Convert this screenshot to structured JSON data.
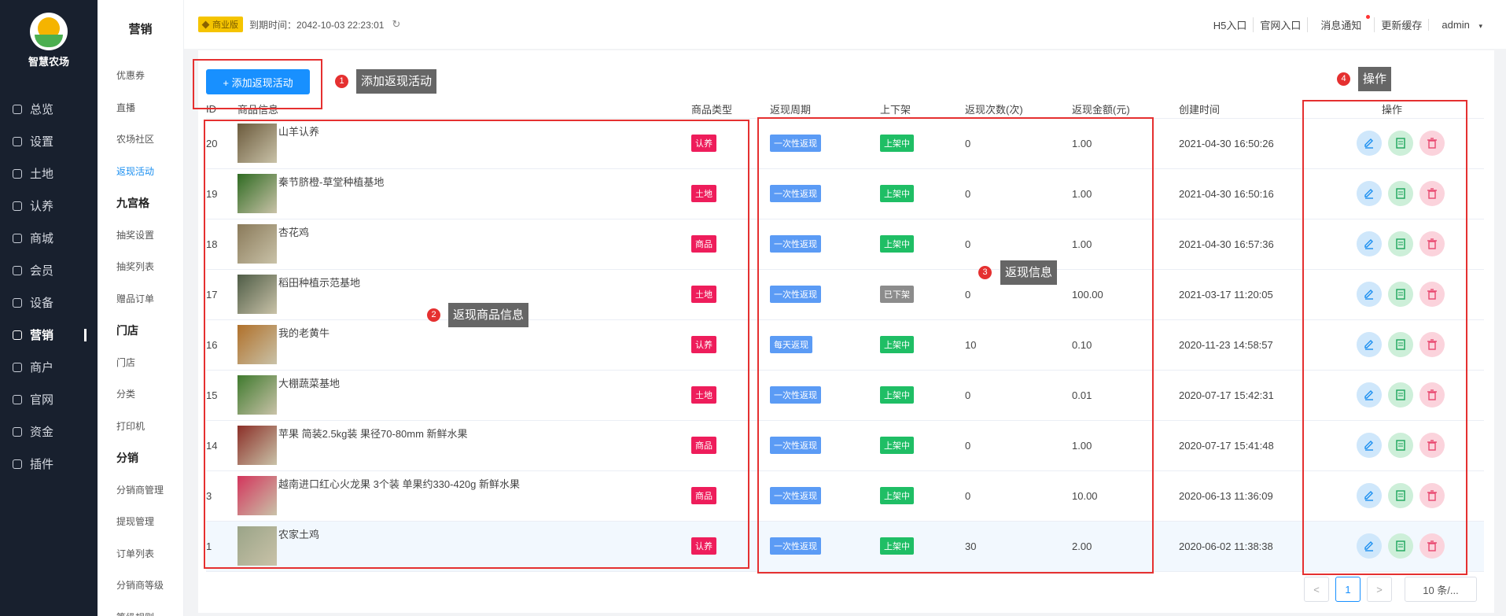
{
  "sidebar": {
    "logo_text": "智慧农场",
    "items": [
      {
        "label": "总览",
        "icon": "dashboard-icon"
      },
      {
        "label": "设置",
        "icon": "gear-icon"
      },
      {
        "label": "土地",
        "icon": "grid-icon"
      },
      {
        "label": "认养",
        "icon": "adopt-icon"
      },
      {
        "label": "商城",
        "icon": "shop-icon"
      },
      {
        "label": "会员",
        "icon": "member-icon"
      },
      {
        "label": "设备",
        "icon": "device-icon"
      },
      {
        "label": "营销",
        "icon": "marketing-icon",
        "active": true
      },
      {
        "label": "商户",
        "icon": "merchant-icon"
      },
      {
        "label": "官网",
        "icon": "website-icon"
      },
      {
        "label": "资金",
        "icon": "funds-icon"
      },
      {
        "label": "插件",
        "icon": "star-icon"
      }
    ]
  },
  "submenu": {
    "title": "营销",
    "items": [
      "优惠券",
      "直播",
      "农场社区",
      "返现活动",
      "九宫格",
      "抽奖设置",
      "抽奖列表",
      "赠品订单",
      "门店",
      "门店",
      "分类",
      "打印机",
      "分销",
      "分销商管理",
      "提现管理",
      "订单列表",
      "分销商等级",
      "等级规则"
    ]
  },
  "topbar": {
    "edition": "商业版",
    "expire": "到期时间：2042-10-03 22:23:01",
    "links": [
      "H5入口",
      "官网入口",
      "消息通知",
      "更新缓存",
      "admin"
    ]
  },
  "add_button": "+ 添加返现活动",
  "table": {
    "headers": [
      "ID",
      "商品信息",
      "商品类型",
      "返现周期",
      "上下架",
      "返现次数(次)",
      "返现金额(元)",
      "创建时间",
      "操作"
    ],
    "rows": [
      {
        "id": "20",
        "name": "山羊认养",
        "type": "认养",
        "cycle": "一次性返现",
        "status": "上架中",
        "count": "0",
        "amount": "1.00",
        "time": "2021-04-30 16:50:26"
      },
      {
        "id": "19",
        "name": "秦节脐橙-草堂种植基地",
        "type": "土地",
        "cycle": "一次性返现",
        "status": "上架中",
        "count": "0",
        "amount": "1.00",
        "time": "2021-04-30 16:50:16"
      },
      {
        "id": "18",
        "name": "杏花鸡",
        "type": "商品",
        "cycle": "一次性返现",
        "status": "上架中",
        "count": "0",
        "amount": "1.00",
        "time": "2021-04-30 16:57:36"
      },
      {
        "id": "17",
        "name": "稻田种植示范基地",
        "type": "土地",
        "cycle": "一次性返现",
        "status": "已下架",
        "count": "0",
        "amount": "100.00",
        "time": "2021-03-17 11:20:05"
      },
      {
        "id": "16",
        "name": "我的老黄牛",
        "type": "认养",
        "cycle": "每天返现",
        "status": "上架中",
        "count": "10",
        "amount": "0.10",
        "time": "2020-11-23 14:58:57"
      },
      {
        "id": "15",
        "name": "大棚蔬菜基地",
        "type": "土地",
        "cycle": "一次性返现",
        "status": "上架中",
        "count": "0",
        "amount": "0.01",
        "time": "2020-07-17 15:42:31"
      },
      {
        "id": "14",
        "name": "苹果 简装2.5kg装 果径70-80mm 新鲜水果",
        "type": "商品",
        "cycle": "一次性返现",
        "status": "上架中",
        "count": "0",
        "amount": "1.00",
        "time": "2020-07-17 15:41:48"
      },
      {
        "id": "3",
        "name": "越南进口红心火龙果 3个装 单果约330-420g 新鲜水果",
        "type": "商品",
        "cycle": "一次性返现",
        "status": "上架中",
        "count": "0",
        "amount": "10.00",
        "time": "2020-06-13 11:36:09"
      },
      {
        "id": "1",
        "name": "农家土鸡",
        "type": "认养",
        "cycle": "一次性返现",
        "status": "上架中",
        "count": "30",
        "amount": "2.00",
        "time": "2020-06-02 11:38:38"
      }
    ]
  },
  "annotations": [
    {
      "num": "1",
      "text": "添加返现活动"
    },
    {
      "num": "2",
      "text": "返现商品信息"
    },
    {
      "num": "3",
      "text": "返现信息"
    },
    {
      "num": "4",
      "text": "操作"
    }
  ],
  "pagination": {
    "prev": "<",
    "current": "1",
    "next": ">",
    "size": "10 条/..."
  },
  "colors": {
    "sidebar_bg": "#18202e",
    "primary": "#1890ff",
    "tag_red": "#ee1d5b",
    "tag_blue": "#5b9bf5",
    "tag_green": "#1fbe65",
    "tag_gray": "#8c8c8c",
    "annotation_red": "#e53030"
  }
}
